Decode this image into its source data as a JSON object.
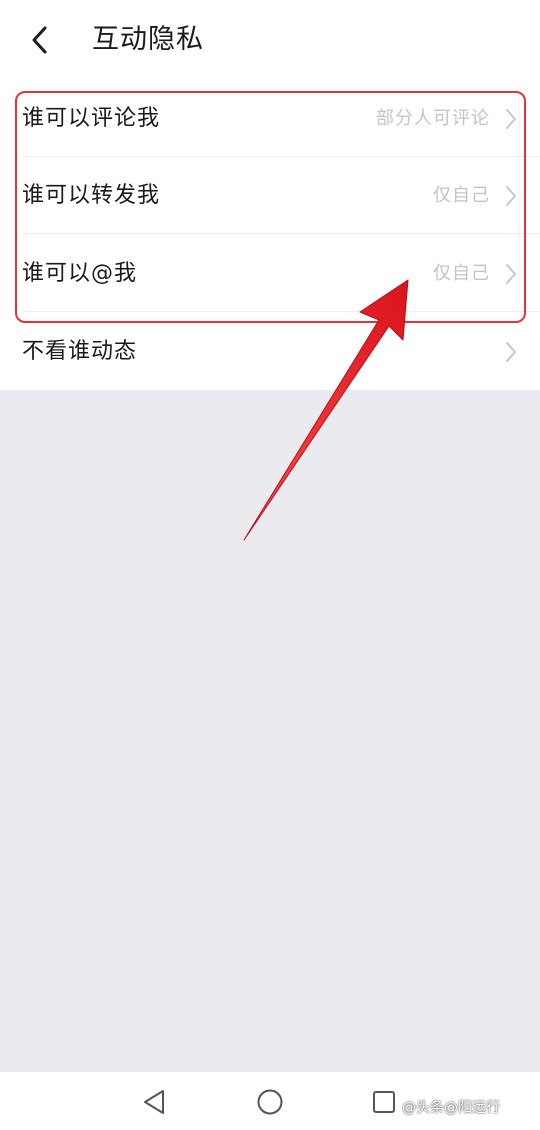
{
  "header": {
    "title": "互动隐私"
  },
  "list": {
    "items": [
      {
        "label": "谁可以评论我",
        "value": "部分人可评论"
      },
      {
        "label": "谁可以转发我",
        "value": "仅自己"
      },
      {
        "label": "谁可以@我",
        "value": "仅自己"
      },
      {
        "label": "不看谁动态",
        "value": ""
      }
    ]
  },
  "annotation": {
    "highlight_color": "#e8323a",
    "arrow_color": "#e8202a"
  },
  "watermark": {
    "text": "@头条@阳远行"
  },
  "icons": {
    "back": "chevron-left-icon",
    "row": "chevron-right-icon",
    "nav_back": "triangle-back-icon",
    "nav_home": "circle-home-icon",
    "nav_recent": "square-recent-icon"
  }
}
